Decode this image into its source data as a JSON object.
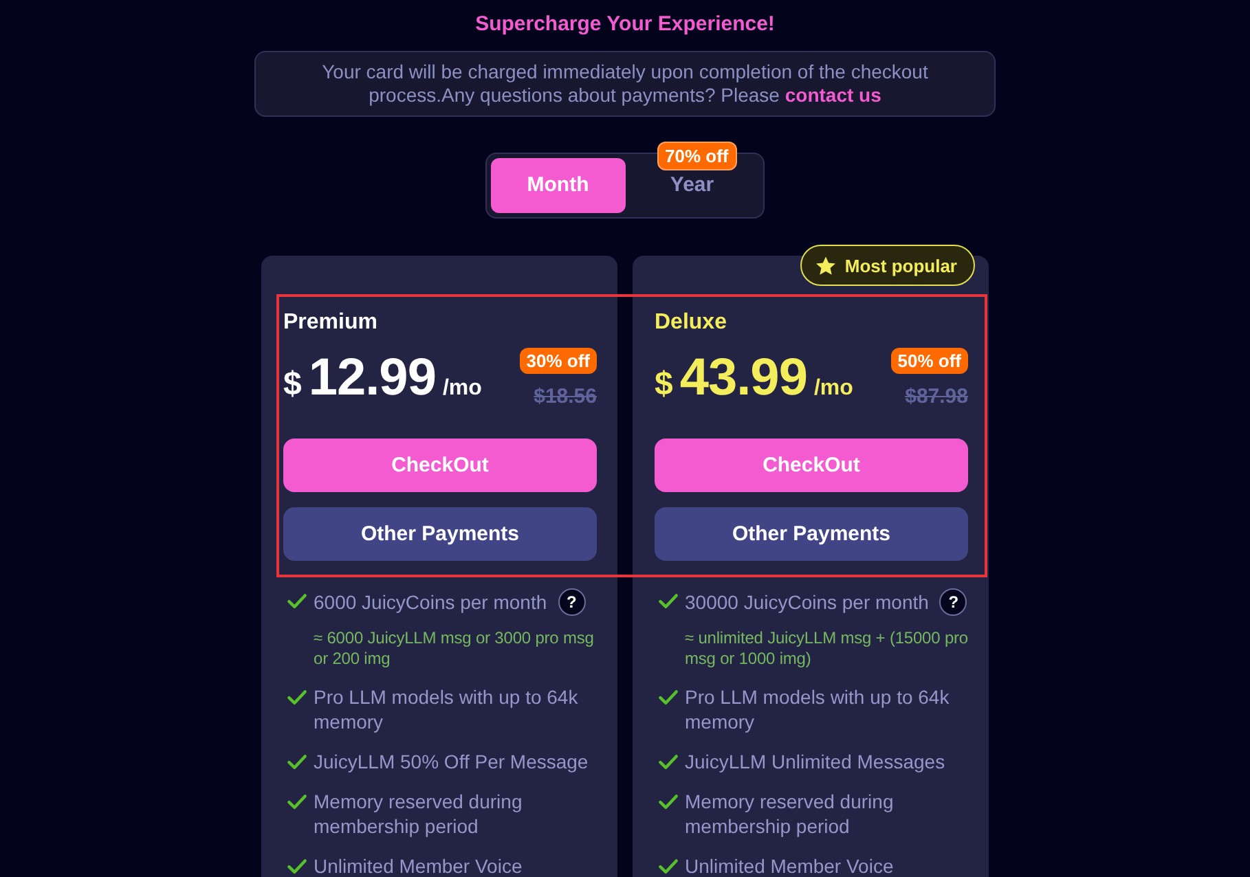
{
  "title": "Supercharge Your Experience!",
  "notice": {
    "text": "Your card will be charged immediately upon completion of the checkout process.Any questions about payments? Please",
    "link": "contact us"
  },
  "billing_toggle": [
    {
      "label": "Month",
      "selected": true
    },
    {
      "label": "Year",
      "selected": false,
      "badge": "70% off"
    }
  ],
  "plans": [
    {
      "name": "Premium",
      "featured": false,
      "currency": "$",
      "price": "12.99",
      "period": "/mo",
      "discount": "30% off",
      "original_price": "$18.56",
      "buttons": [
        {
          "label": "CheckOut",
          "kind": "primary"
        },
        {
          "label": "Other Payments",
          "kind": "secondary"
        }
      ],
      "features": [
        {
          "text": "6000 JuicyCoins per month",
          "help": "?",
          "note": "≈ 6000 JuicyLLM msg or 3000 pro msg or 200 img"
        },
        {
          "text": "Pro LLM models with up to 64k memory"
        },
        {
          "text": "JuicyLLM 50% Off Per Message"
        },
        {
          "text": "Memory reserved during membership period"
        },
        {
          "text": "Unlimited Member Voice"
        }
      ]
    },
    {
      "name": "Deluxe",
      "featured": true,
      "badge": "Most popular",
      "currency": "$",
      "price": "43.99",
      "period": "/mo",
      "discount": "50% off",
      "original_price": "$87.98",
      "buttons": [
        {
          "label": "CheckOut",
          "kind": "primary"
        },
        {
          "label": "Other Payments",
          "kind": "secondary"
        }
      ],
      "features": [
        {
          "text": "30000 JuicyCoins per month",
          "help": "?",
          "note": "≈ unlimited JuicyLLM msg + (15000 pro msg or 1000 img)"
        },
        {
          "text": "Pro LLM models with up to 64k memory"
        },
        {
          "text": "JuicyLLM Unlimited Messages"
        },
        {
          "text": "Memory reserved during membership period"
        },
        {
          "text": "Unlimited Member Voice"
        }
      ]
    }
  ],
  "highlight_frame": true
}
